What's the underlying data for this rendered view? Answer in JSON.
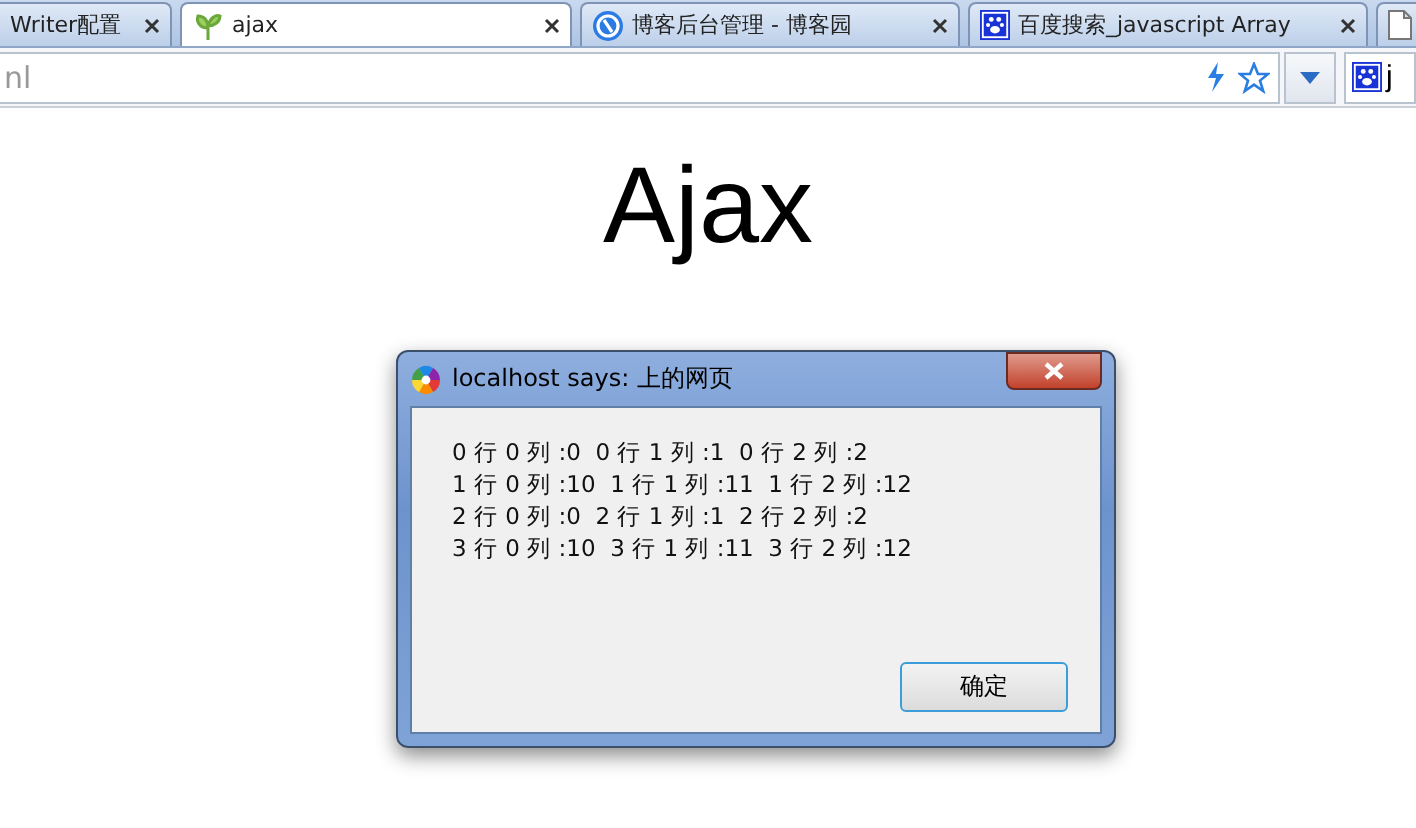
{
  "tabs": [
    {
      "kind": "page",
      "label": "Writer配置",
      "selected": false
    },
    {
      "kind": "page",
      "label": "ajax",
      "selected": true
    },
    {
      "kind": "page",
      "label": "博客后台管理 - 博客园",
      "selected": false
    },
    {
      "kind": "page",
      "label": "百度搜索_javascript Array",
      "selected": false
    },
    {
      "kind": "blank",
      "selected": false
    }
  ],
  "address_bar": {
    "value": "nl",
    "extension_label": "j"
  },
  "page": {
    "heading": "Ajax"
  },
  "dialog": {
    "title": "localhost says: 上的网页",
    "lines": [
      "0 行 0 列 :0  0 行 1 列 :1  0 行 2 列 :2",
      "1 行 0 列 :10  1 行 1 列 :11  1 行 2 列 :12",
      "2 行 0 列 :0  2 行 1 列 :1  2 行 2 列 :2",
      "3 行 0 列 :10  3 行 1 列 :11  3 行 2 列 :12"
    ],
    "button": "确定"
  }
}
